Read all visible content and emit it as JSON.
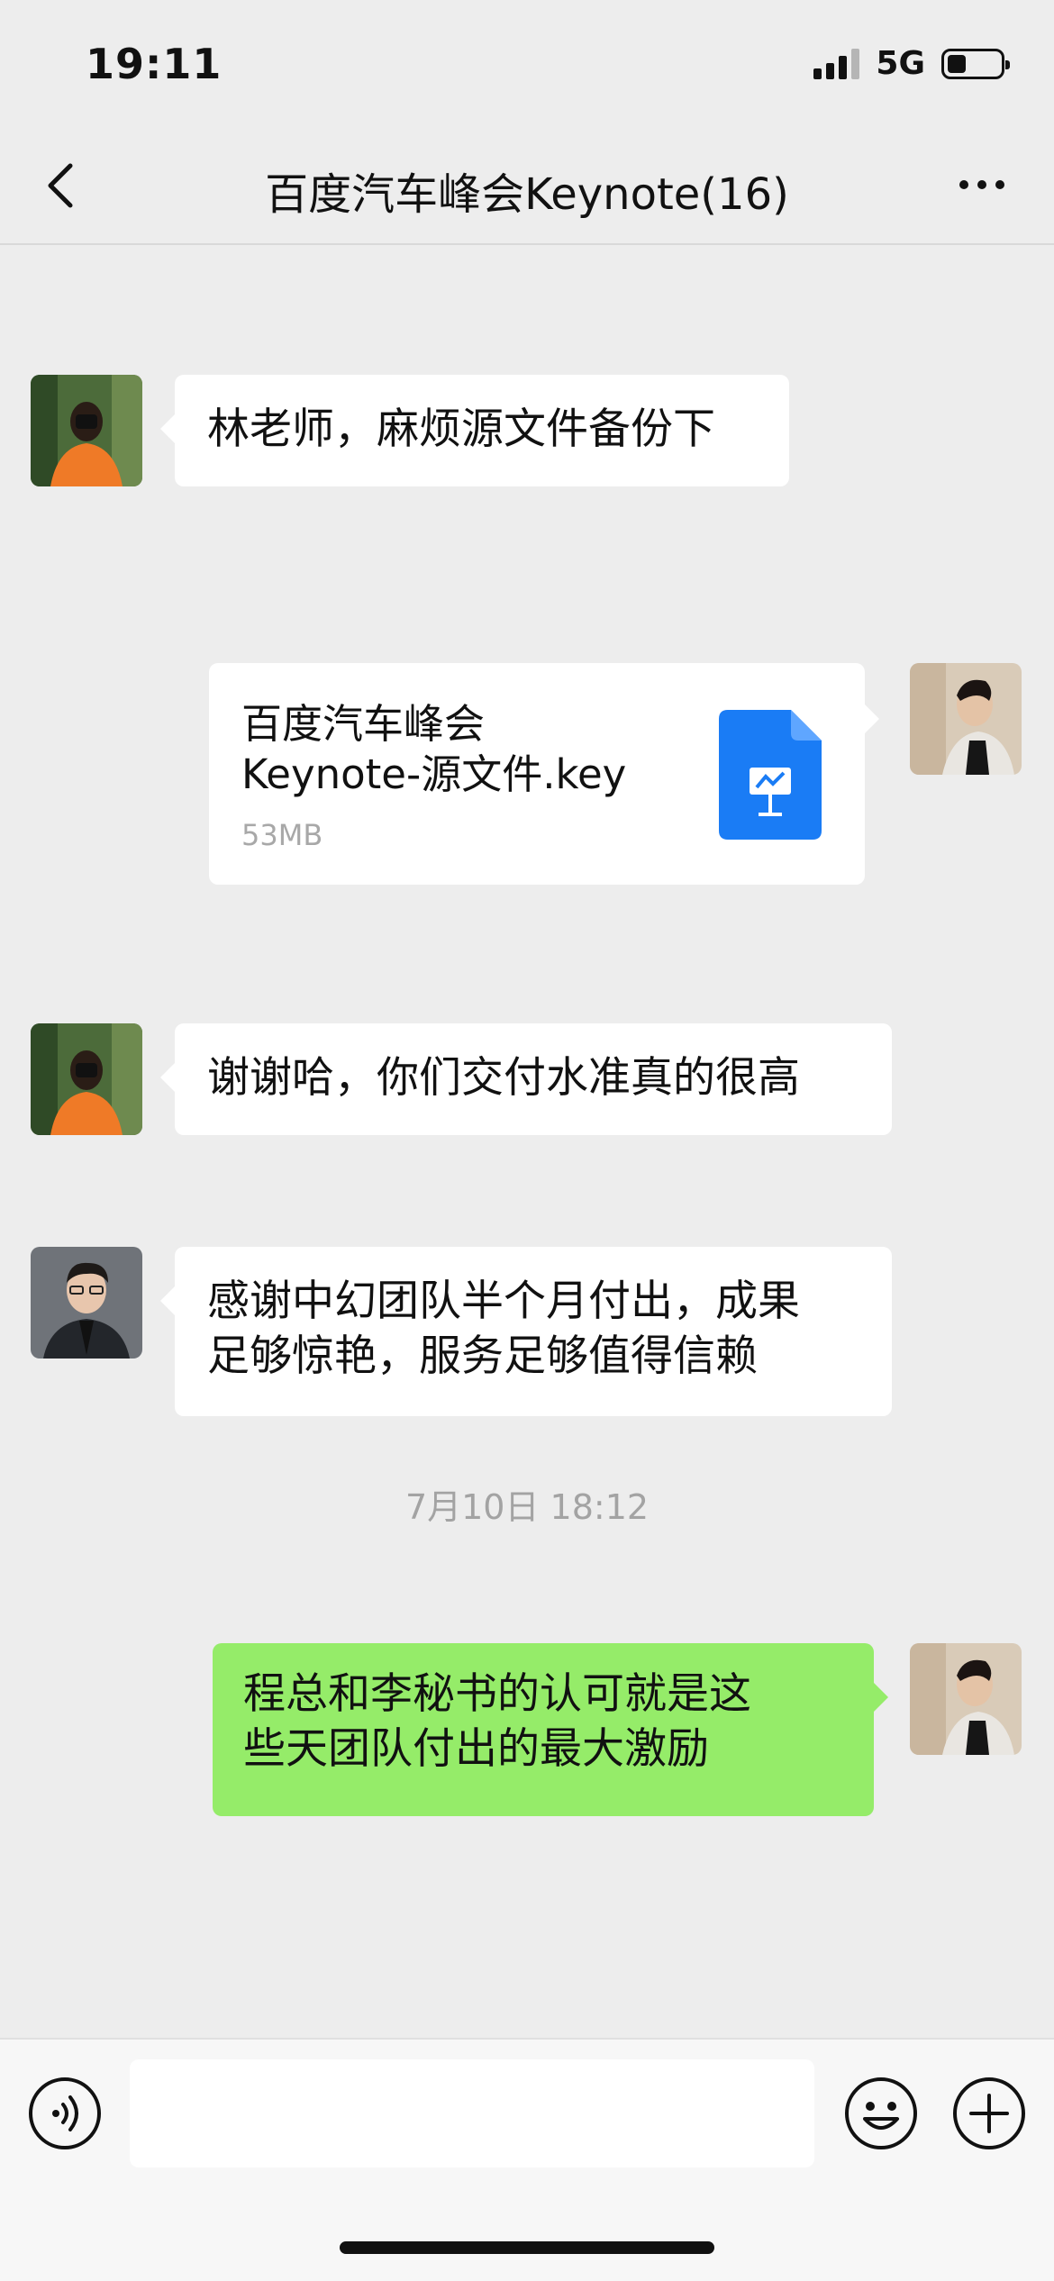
{
  "status_bar": {
    "time": "19:11",
    "network": "5G",
    "signal_bars": 4,
    "signal_bars_active": 3,
    "battery_level": 0.3
  },
  "nav": {
    "title": "百度汽车峰会Keynote(16)",
    "back_icon": "chevron-left-icon",
    "more_icon": "ellipsis-icon"
  },
  "messages": [
    {
      "side": "left",
      "sender_avatar": "woman-orange-sweater-camera",
      "text": "林老师，麻烦源文件备份下"
    },
    {
      "side": "right",
      "sender_avatar": "man-profile-photo",
      "type": "file",
      "file_name_line1": "百度汽车峰会",
      "file_name_line2": "Keynote-源文件.key",
      "file_size": "53MB",
      "file_icon": "keynote-icon"
    },
    {
      "side": "left",
      "sender_avatar": "woman-orange-sweater-camera",
      "text": "谢谢哈，你们交付水准真的很高"
    },
    {
      "side": "left",
      "sender_avatar": "man-glasses-suit",
      "text_line1": "感谢中幻团队半个月付出，成果",
      "text_line2": "足够惊艳，服务足够值得信赖"
    },
    {
      "side": "right",
      "sender_avatar": "man-profile-photo",
      "text_line1": "程总和李秘书的认可就是这",
      "text_line2": "些天团队付出的最大激励"
    }
  ],
  "timestamp": "7月10日 18:12",
  "colors": {
    "background": "#ededed",
    "bubble_incoming": "#ffffff",
    "bubble_outgoing": "#95ec69",
    "file_icon": "#1a7cf5"
  },
  "input_bar": {
    "voice_icon": "voice-icon",
    "emoji_icon": "emoji-icon",
    "plus_icon": "plus-icon",
    "input_value": ""
  }
}
